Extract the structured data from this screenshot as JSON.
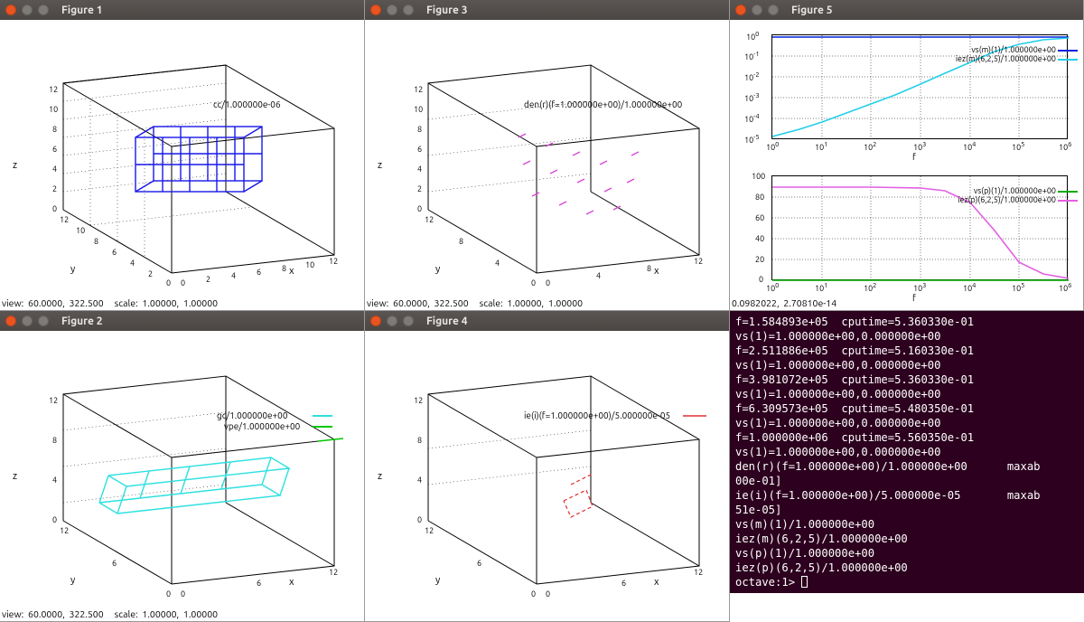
{
  "figures": {
    "f1": {
      "title": "Figure 1",
      "plot_label": "cc/1.000000e-06",
      "status": "view:  60.0000,  322.500     scale:  1.00000,  1.00000",
      "zlabel": "z",
      "xlabel": "x",
      "ylabel": "y",
      "zticks": [
        "0",
        "2",
        "4",
        "6",
        "8",
        "10",
        "12"
      ],
      "xyticks": [
        "0",
        "2",
        "4",
        "6",
        "8",
        "10",
        "12"
      ]
    },
    "f2": {
      "title": "Figure 2",
      "plot_label": "gc/1.000000e+00",
      "plot_label2": "vpe/1.000000e+00",
      "status": "view:  60.0000,  322.500     scale:  1.00000,  1.00000",
      "zlabel": "z",
      "xlabel": "x",
      "ylabel": "y"
    },
    "f3": {
      "title": "Figure 3",
      "plot_label": "den(r)(f=1.000000e+00)/1.000000e+00",
      "status": "view:  60.0000,  322.500     scale:  1.00000,  1.00000",
      "zlabel": "z",
      "xlabel": "x",
      "ylabel": "y"
    },
    "f4": {
      "title": "Figure 4",
      "plot_label": "ie(i)(f=1.000000e+00)/5.000000e-05",
      "status": "",
      "zlabel": "z",
      "xlabel": "x",
      "ylabel": "y"
    },
    "f5": {
      "title": "Figure 5",
      "top_legend1": "vs(m)(1)/1.000000e+00",
      "top_legend2": "iez(m)(6,2,5)/1.000000e+00",
      "bot_legend1": "vs(p)(1)/1.000000e+00",
      "bot_legend2": "iez(p)(6,2,5)/1.000000e+00",
      "xlabel": "f",
      "status": "0.0982022,  2.70810e-14"
    }
  },
  "chart_data": [
    {
      "type": "3d-wire",
      "figure": 1,
      "label": "cc/1.000000e-06",
      "axes": {
        "x": [
          0,
          12
        ],
        "y": [
          0,
          12
        ],
        "z": [
          0,
          12
        ]
      },
      "overlay": "blue mesh block near center"
    },
    {
      "type": "3d-wire",
      "figure": 2,
      "label": "gc/1.000000e+00",
      "axes": {
        "x": [
          0,
          12
        ],
        "y": [
          0,
          12
        ],
        "z": [
          0,
          12
        ]
      },
      "overlay": "cyan grid plane + green vpe line"
    },
    {
      "type": "3d-scatter",
      "figure": 3,
      "label": "den(r)(f=1.000000e+00)/1.000000e+00",
      "axes": {
        "x": [
          0,
          12
        ],
        "y": [
          0,
          12
        ],
        "z": [
          0,
          12
        ]
      },
      "overlay": "magenta scatter points"
    },
    {
      "type": "3d-line",
      "figure": 4,
      "label": "ie(i)(f=1.000000e+00)/5.000000e-05",
      "axes": {
        "x": [
          0,
          12
        ],
        "y": [
          0,
          12
        ],
        "z": [
          0,
          12
        ]
      },
      "overlay": "red small wire",
      "legend_accent": "red dash top-right"
    },
    {
      "type": "line",
      "figure": "5-top",
      "title": "",
      "xlabel": "f",
      "ylabel": "",
      "xscale": "log",
      "yscale": "log",
      "xlim": [
        1,
        1000000.0
      ],
      "ylim": [
        1e-05,
        1
      ],
      "xticks": [
        "10^0",
        "10^1",
        "10^2",
        "10^3",
        "10^4",
        "10^5",
        "10^6"
      ],
      "yticks": [
        "10^-5",
        "10^-4",
        "10^-3",
        "10^-2",
        "10^-1",
        "10^0"
      ],
      "series": [
        {
          "name": "vs(m)(1)/1.000000e+00",
          "color": "#0022dd",
          "x": [
            1,
            1000000.0
          ],
          "y": [
            1,
            1
          ]
        },
        {
          "name": "iez(m)(6,2,5)/1.000000e+00",
          "color": "#22cfe8",
          "x": [
            1,
            3,
            10,
            30,
            100,
            300,
            1000,
            3000,
            10000.0,
            30000.0,
            100000.0,
            300000.0,
            1000000.0
          ],
          "y": [
            2e-05,
            5e-05,
            0.00012,
            0.0004,
            0.0012,
            0.004,
            0.012,
            0.04,
            0.12,
            0.35,
            0.7,
            0.9,
            1.0
          ]
        }
      ]
    },
    {
      "type": "line",
      "figure": "5-bot",
      "title": "",
      "xlabel": "f",
      "ylabel": "",
      "xscale": "log",
      "yscale": "linear",
      "xlim": [
        1,
        1000000.0
      ],
      "ylim": [
        0,
        100
      ],
      "xticks": [
        "10^0",
        "10^1",
        "10^2",
        "10^3",
        "10^4",
        "10^5",
        "10^6"
      ],
      "yticks": [
        "0",
        "20",
        "40",
        "60",
        "80",
        "100"
      ],
      "series": [
        {
          "name": "vs(p)(1)/1.000000e+00",
          "color": "#00aa00",
          "x": [
            1,
            1000000.0
          ],
          "y": [
            0,
            0
          ]
        },
        {
          "name": "iez(p)(6,2,5)/1.000000e+00",
          "color": "#e260e2",
          "x": [
            1,
            10,
            100,
            1000,
            3000,
            10000.0,
            30000.0,
            100000.0,
            300000.0,
            1000000.0
          ],
          "y": [
            90,
            90,
            90,
            89,
            86,
            75,
            48,
            18,
            6,
            2
          ]
        }
      ]
    }
  ],
  "terminal": {
    "lines": [
      "f=1.584893e+05  cputime=5.360330e-01",
      "vs(1)=1.000000e+00,0.000000e+00",
      "f=2.511886e+05  cputime=5.160330e-01",
      "vs(1)=1.000000e+00,0.000000e+00",
      "f=3.981072e+05  cputime=5.360330e-01",
      "vs(1)=1.000000e+00,0.000000e+00",
      "f=6.309573e+05  cputime=5.480350e-01",
      "vs(1)=1.000000e+00,0.000000e+00",
      "f=1.000000e+06  cputime=5.560350e-01",
      "vs(1)=1.000000e+00,0.000000e+00",
      "den(r)(f=1.000000e+00)/1.000000e+00      maxab",
      "00e-01]",
      "ie(i)(f=1.000000e+00)/5.000000e-05       maxab",
      "51e-05]",
      "vs(m)(1)/1.000000e+00",
      "iez(m)(6,2,5)/1.000000e+00",
      "vs(p)(1)/1.000000e+00",
      "iez(p)(6,2,5)/1.000000e+00"
    ],
    "prompt": "octave:1> "
  }
}
